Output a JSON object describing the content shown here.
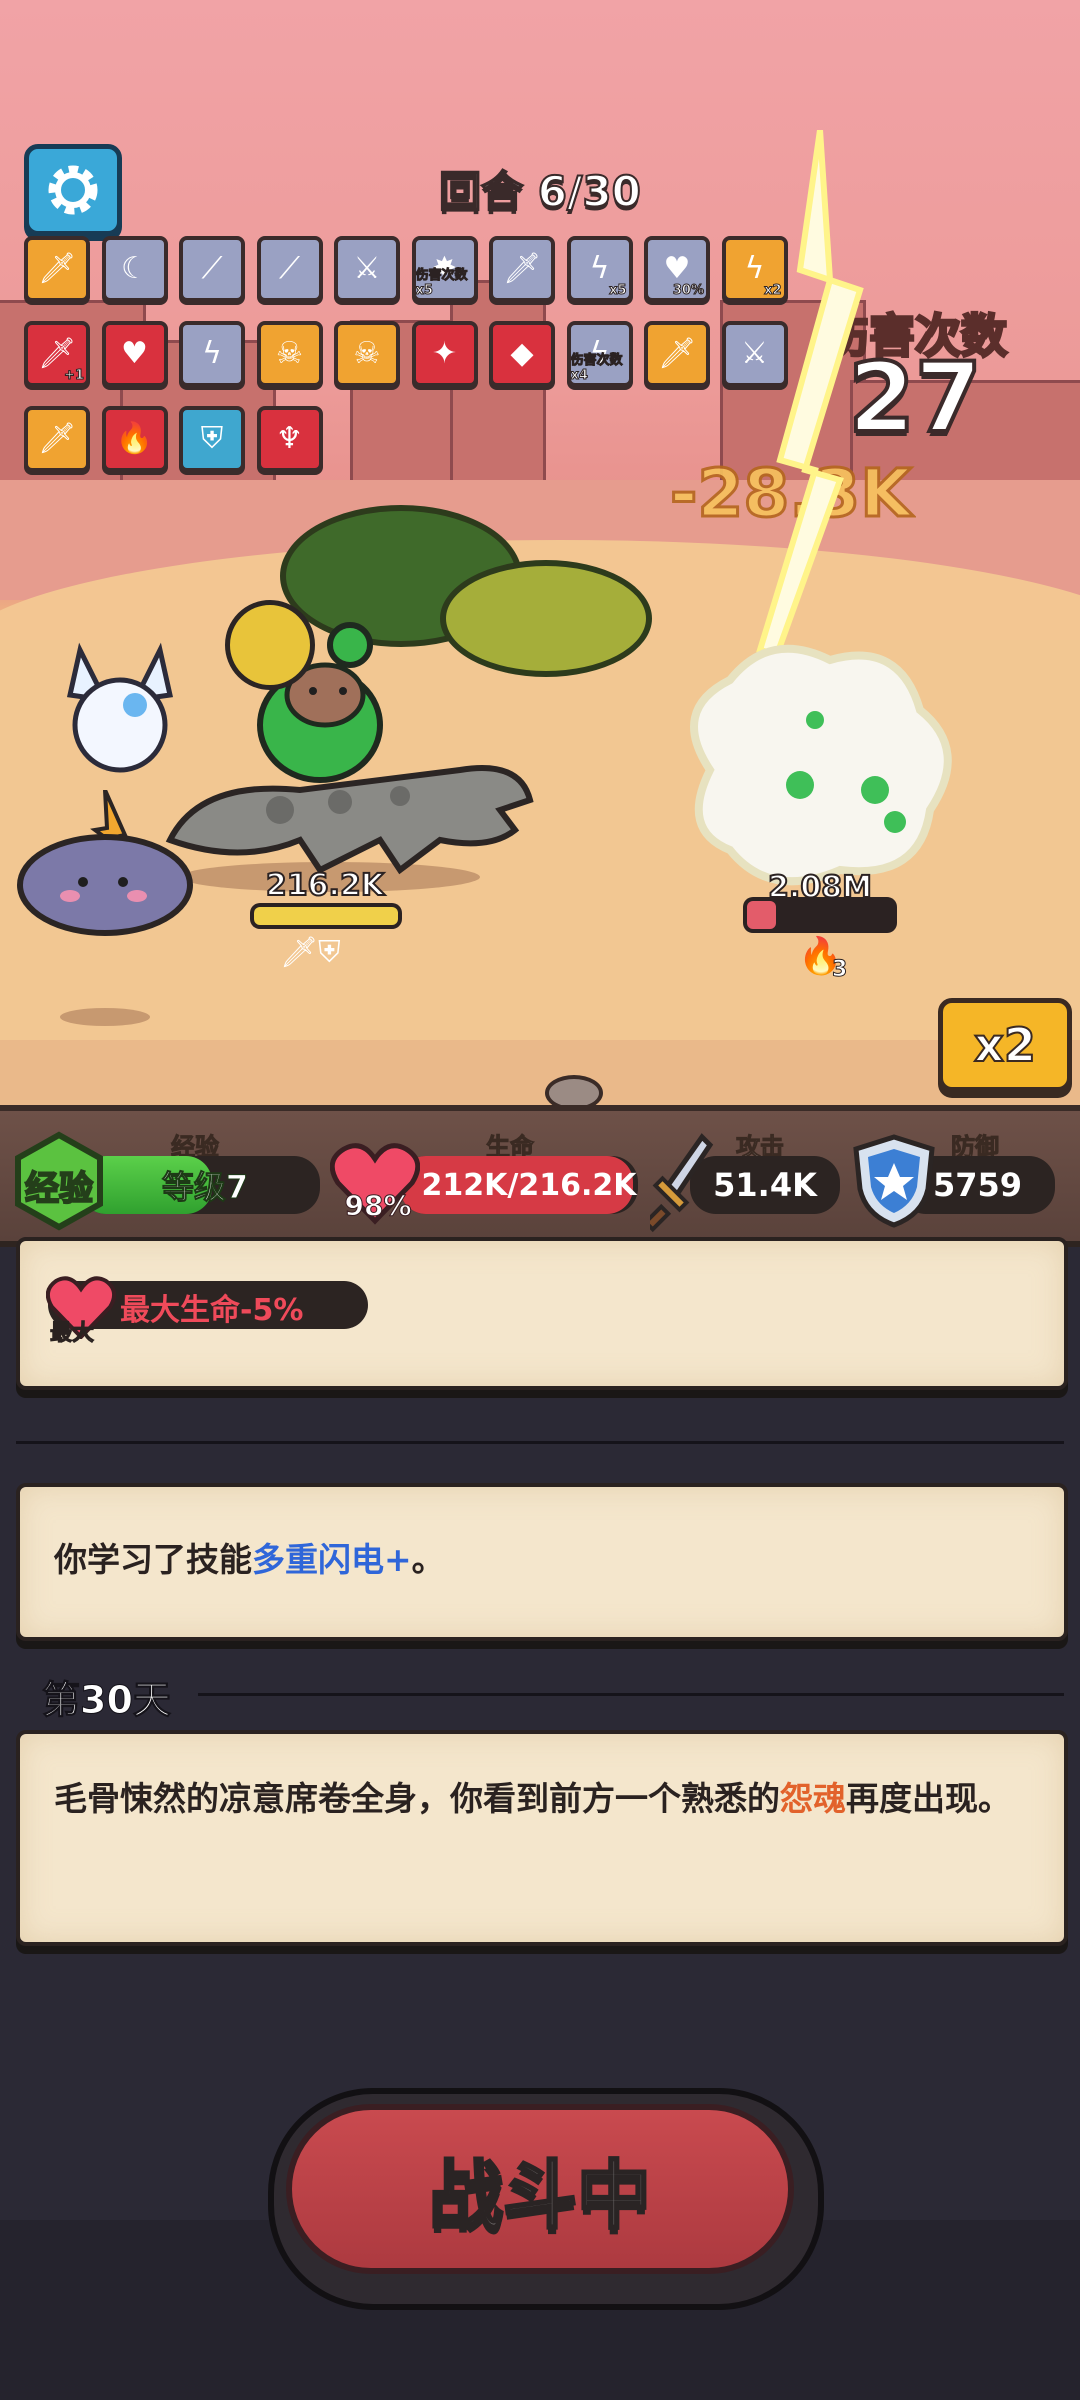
{
  "hud": {
    "round_text": "回合 6/30",
    "settings_icon": "gear-icon"
  },
  "skills": [
    {
      "icon": "sword-plus-icon",
      "style": "orange",
      "badge": ""
    },
    {
      "icon": "crescent-icon",
      "style": "gray",
      "badge": ""
    },
    {
      "icon": "spear-icon",
      "style": "gray",
      "badge": ""
    },
    {
      "icon": "spear-plus-icon",
      "style": "gray",
      "badge": ""
    },
    {
      "icon": "crossed-swords-icon",
      "style": "gray",
      "badge": ""
    },
    {
      "icon": "ice-burst-icon",
      "style": "gray",
      "badge": "伤害次数 x5"
    },
    {
      "icon": "sword-ice-icon",
      "style": "gray",
      "badge": ""
    },
    {
      "icon": "lightning-icon",
      "style": "gray",
      "badge": "x5"
    },
    {
      "icon": "heart-icon",
      "style": "gray",
      "badge": "30%"
    },
    {
      "icon": "lightning-icon",
      "style": "orange",
      "badge": "x2"
    },
    {
      "icon": "sword-plus-icon",
      "style": "red",
      "badge": "+1"
    },
    {
      "icon": "heart-icon",
      "style": "red",
      "badge": ""
    },
    {
      "icon": "lightning-icon",
      "style": "gray",
      "badge": ""
    },
    {
      "icon": "skull-ice-icon",
      "style": "orange",
      "badge": ""
    },
    {
      "icon": "lightning-skull-icon",
      "style": "orange",
      "badge": ""
    },
    {
      "icon": "sword-burst-icon",
      "style": "red",
      "badge": ""
    },
    {
      "icon": "ice-crystal-icon",
      "style": "red",
      "badge": ""
    },
    {
      "icon": "lightning-icon",
      "style": "gray",
      "badge": "伤害次数 x4"
    },
    {
      "icon": "sword-fire-icon",
      "style": "orange",
      "badge": ""
    },
    {
      "icon": "sword-cross-icon",
      "style": "gray",
      "badge": ""
    },
    {
      "icon": "sword-icon",
      "style": "orange",
      "badge": ""
    },
    {
      "icon": "fire-icon",
      "style": "red",
      "badge": ""
    },
    {
      "icon": "sword-shield-icon",
      "style": "cyan",
      "badge": ""
    },
    {
      "icon": "devil-icon",
      "style": "red",
      "badge": ""
    }
  ],
  "combat": {
    "hit_count_title": "伤害次数",
    "hit_count": "27",
    "damage_text": "-28.3K",
    "player_hp": "216.2K",
    "enemy_hp": "2.08M",
    "enemy_burn_stacks": "3",
    "speed_label": "x2"
  },
  "stats": {
    "exp_label": "经验",
    "exp_badge": "经验",
    "level_text": "等级7",
    "hp_label": "生命",
    "hp_percent": "98%",
    "hp_value": "212K/216.2K",
    "atk_label": "攻击",
    "atk_value": "51.4K",
    "def_label": "防御",
    "def_value": "5759",
    "exp_fraction": 0.55,
    "hp_fraction": 0.98
  },
  "log": {
    "buff_small": "最大",
    "buff_text": "最大生命-5%",
    "learn_prefix": "你学习了技能",
    "learn_skill": "多重闪电+",
    "learn_suffix": "。",
    "day_title": "第30天",
    "story_prefix": "毛骨悚然的凉意席卷全身，你看到前方一个熟悉的",
    "story_highlight": "怨魂",
    "story_suffix": "再度出现。"
  },
  "battle_button": {
    "label": "战斗中"
  },
  "colors": {
    "accent_blue": "#2f66d9",
    "accent_orange": "#e2622b",
    "hp_red": "#d63a45",
    "exp_green": "#3fb43c",
    "button_red": "#c94a4f"
  }
}
